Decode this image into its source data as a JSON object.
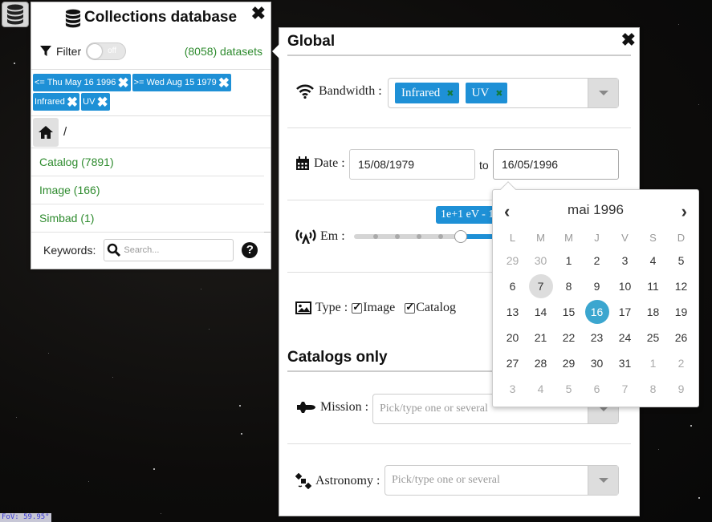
{
  "fov_label": "FoV: 59.95°",
  "collections": {
    "title": "Collections database",
    "filter_label": "Filter",
    "toggle_label": "off",
    "datasets_count": "(8058) datasets",
    "chips": [
      {
        "label": "<= Thu May 16 1996"
      },
      {
        "label": ">= Wed Aug 15 1979"
      },
      {
        "label": "Infrared"
      },
      {
        "label": "UV"
      }
    ],
    "path": "/",
    "results": [
      {
        "label": "Catalog (7891)"
      },
      {
        "label": "Image (166)"
      },
      {
        "label": "Simbad (1)"
      }
    ],
    "keywords_label": "Keywords:",
    "search_placeholder": "Search..."
  },
  "global": {
    "title": "Global",
    "bandwidth_label": "Bandwidth :",
    "bandwidth_tags": [
      {
        "label": "Infrared"
      },
      {
        "label": "UV"
      }
    ],
    "date_label": "Date :",
    "date_from": "15/08/1979",
    "date_to_word": "to",
    "date_to": "16/05/1996",
    "em_label": "Em :",
    "em_tooltip": "1e+1 eV - 1",
    "type_label": "Type :",
    "type_options": [
      {
        "label": "Image",
        "checked": true
      },
      {
        "label": "Catalog",
        "checked": true
      }
    ],
    "catalogs_title": "Catalogs only",
    "mission_label": "Mission :",
    "mission_placeholder": "Pick/type one or several",
    "astronomy_label": "Astronomy :",
    "astronomy_placeholder": "Pick/type one or several"
  },
  "datepicker": {
    "month_label": "mai 1996",
    "weekdays": [
      "L",
      "M",
      "M",
      "J",
      "V",
      "S",
      "D"
    ],
    "weeks": [
      [
        "29",
        "30",
        "1",
        "2",
        "3",
        "4",
        "5"
      ],
      [
        "6",
        "7",
        "8",
        "9",
        "10",
        "11",
        "12"
      ],
      [
        "13",
        "14",
        "15",
        "16",
        "17",
        "18",
        "19"
      ],
      [
        "20",
        "21",
        "22",
        "23",
        "24",
        "25",
        "26"
      ],
      [
        "27",
        "28",
        "29",
        "30",
        "31",
        "1",
        "2"
      ],
      [
        "3",
        "4",
        "5",
        "6",
        "7",
        "8",
        "9"
      ]
    ],
    "today": "7",
    "selected": "16"
  },
  "colors": {
    "accent": "#1e90d6",
    "count_green": "#2e8b2e",
    "selected_day": "#3ba6cf"
  }
}
